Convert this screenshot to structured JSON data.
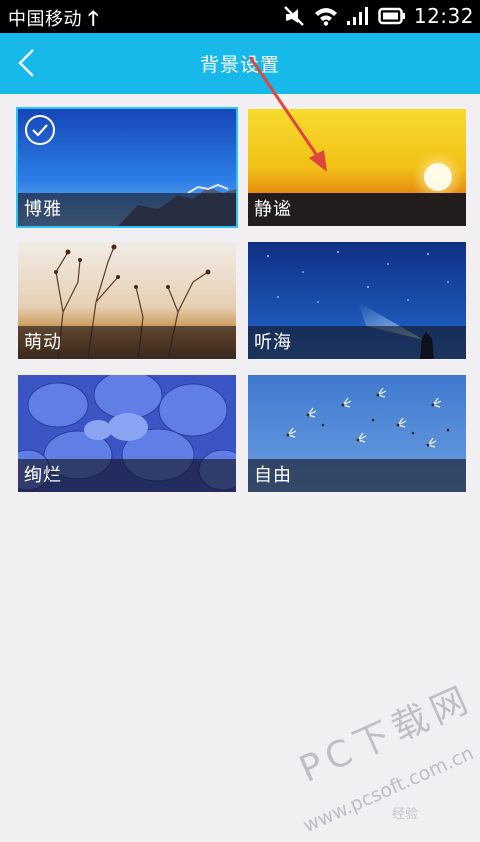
{
  "status_bar": {
    "carrier": "中国移动",
    "time": "12:32",
    "icons": [
      "upload-arrow-icon",
      "muted-icon",
      "wifi-icon",
      "signal-icon",
      "battery-icon"
    ]
  },
  "header": {
    "title": "背景设置",
    "back_icon": "back-chevron-icon",
    "color": "#17b8ea"
  },
  "backgrounds": [
    {
      "label": "博雅",
      "selected": true
    },
    {
      "label": "静谧",
      "selected": false
    },
    {
      "label": "萌动",
      "selected": false
    },
    {
      "label": "听海",
      "selected": false
    },
    {
      "label": "绚烂",
      "selected": false
    },
    {
      "label": "自由",
      "selected": false
    }
  ],
  "watermark": {
    "brand": "PC下载网",
    "url": "www.pcsoft.com.cn",
    "small": "经验"
  }
}
